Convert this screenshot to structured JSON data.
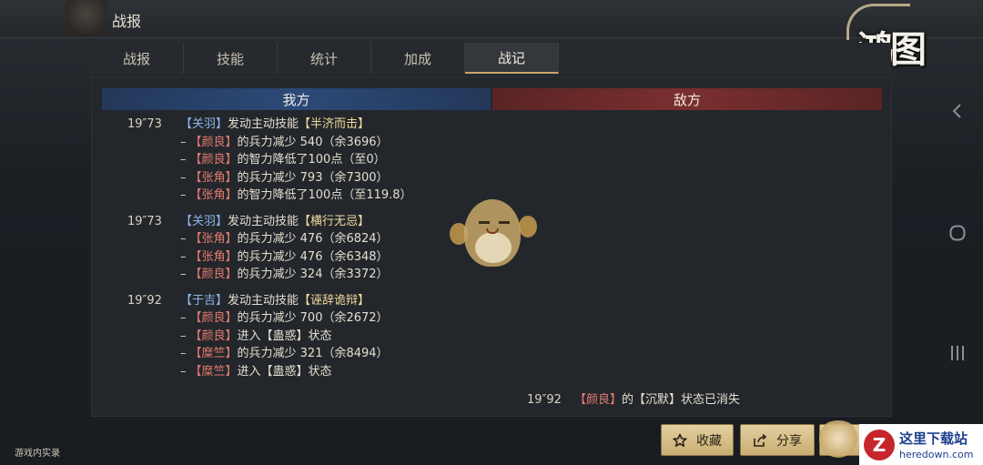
{
  "header": {
    "title": "战报"
  },
  "logo": {
    "text": "鸿图"
  },
  "tabs": [
    {
      "label": "战报",
      "active": false
    },
    {
      "label": "技能",
      "active": false
    },
    {
      "label": "统计",
      "active": false
    },
    {
      "label": "加成",
      "active": false
    },
    {
      "label": "战记",
      "active": true
    }
  ],
  "sides": {
    "ours": "我方",
    "enemy": "敌方"
  },
  "log_blocks": [
    {
      "time": "19″73",
      "actor": "【关羽】",
      "action": "发动主动技能",
      "skill": "【半济而击】",
      "effects": [
        {
          "target": "【颜良】",
          "text": "的兵力减少 540（余3696）"
        },
        {
          "target": "【颜良】",
          "text": "的智力降低了100点（至0）"
        },
        {
          "target": "【张角】",
          "text": "的兵力减少 793（余7300）"
        },
        {
          "target": "【张角】",
          "text": "的智力降低了100点（至119.8）"
        }
      ]
    },
    {
      "time": "19″73",
      "actor": "【关羽】",
      "action": "发动主动技能",
      "skill": "【横行无忌】",
      "effects": [
        {
          "target": "【张角】",
          "text": "的兵力减少 476（余6824）"
        },
        {
          "target": "【张角】",
          "text": "的兵力减少 476（余6348）"
        },
        {
          "target": "【颜良】",
          "text": "的兵力减少 324（余3372）"
        }
      ]
    },
    {
      "time": "19″92",
      "actor": "【于吉】",
      "action": "发动主动技能",
      "skill": "【诬辞诡辩】",
      "effects": [
        {
          "target": "【颜良】",
          "text": "的兵力减少 700（余2672）"
        },
        {
          "target": "【颜良】",
          "text": "进入【蛊惑】状态"
        },
        {
          "target": "【糜竺】",
          "text": "的兵力减少 321（余8494）"
        },
        {
          "target": "【糜竺】",
          "text": "进入【蛊惑】状态"
        }
      ]
    }
  ],
  "enemy_log": {
    "time": "19″92",
    "target": "【颜良】",
    "text": "的【沉默】状态已消失"
  },
  "buttons": {
    "favorite": "收藏",
    "share": "分享"
  },
  "footer_note": "游戏内实录",
  "watermark": {
    "logo": "Z",
    "title": "这里下载站",
    "url": "heredown.com"
  },
  "colors": {
    "ally_hero": "#8fb4e8",
    "enemy_hero": "#e27a6e",
    "skill": "#f2d99a",
    "our_side": "#2c4a78",
    "enemy_side": "#7a2f2f",
    "button_gold": "#d6bf89"
  },
  "icons": {
    "favorite": "star-icon",
    "share": "share-icon",
    "back": "chevron-left-icon",
    "home": "circle-icon",
    "recents": "bars-icon"
  }
}
